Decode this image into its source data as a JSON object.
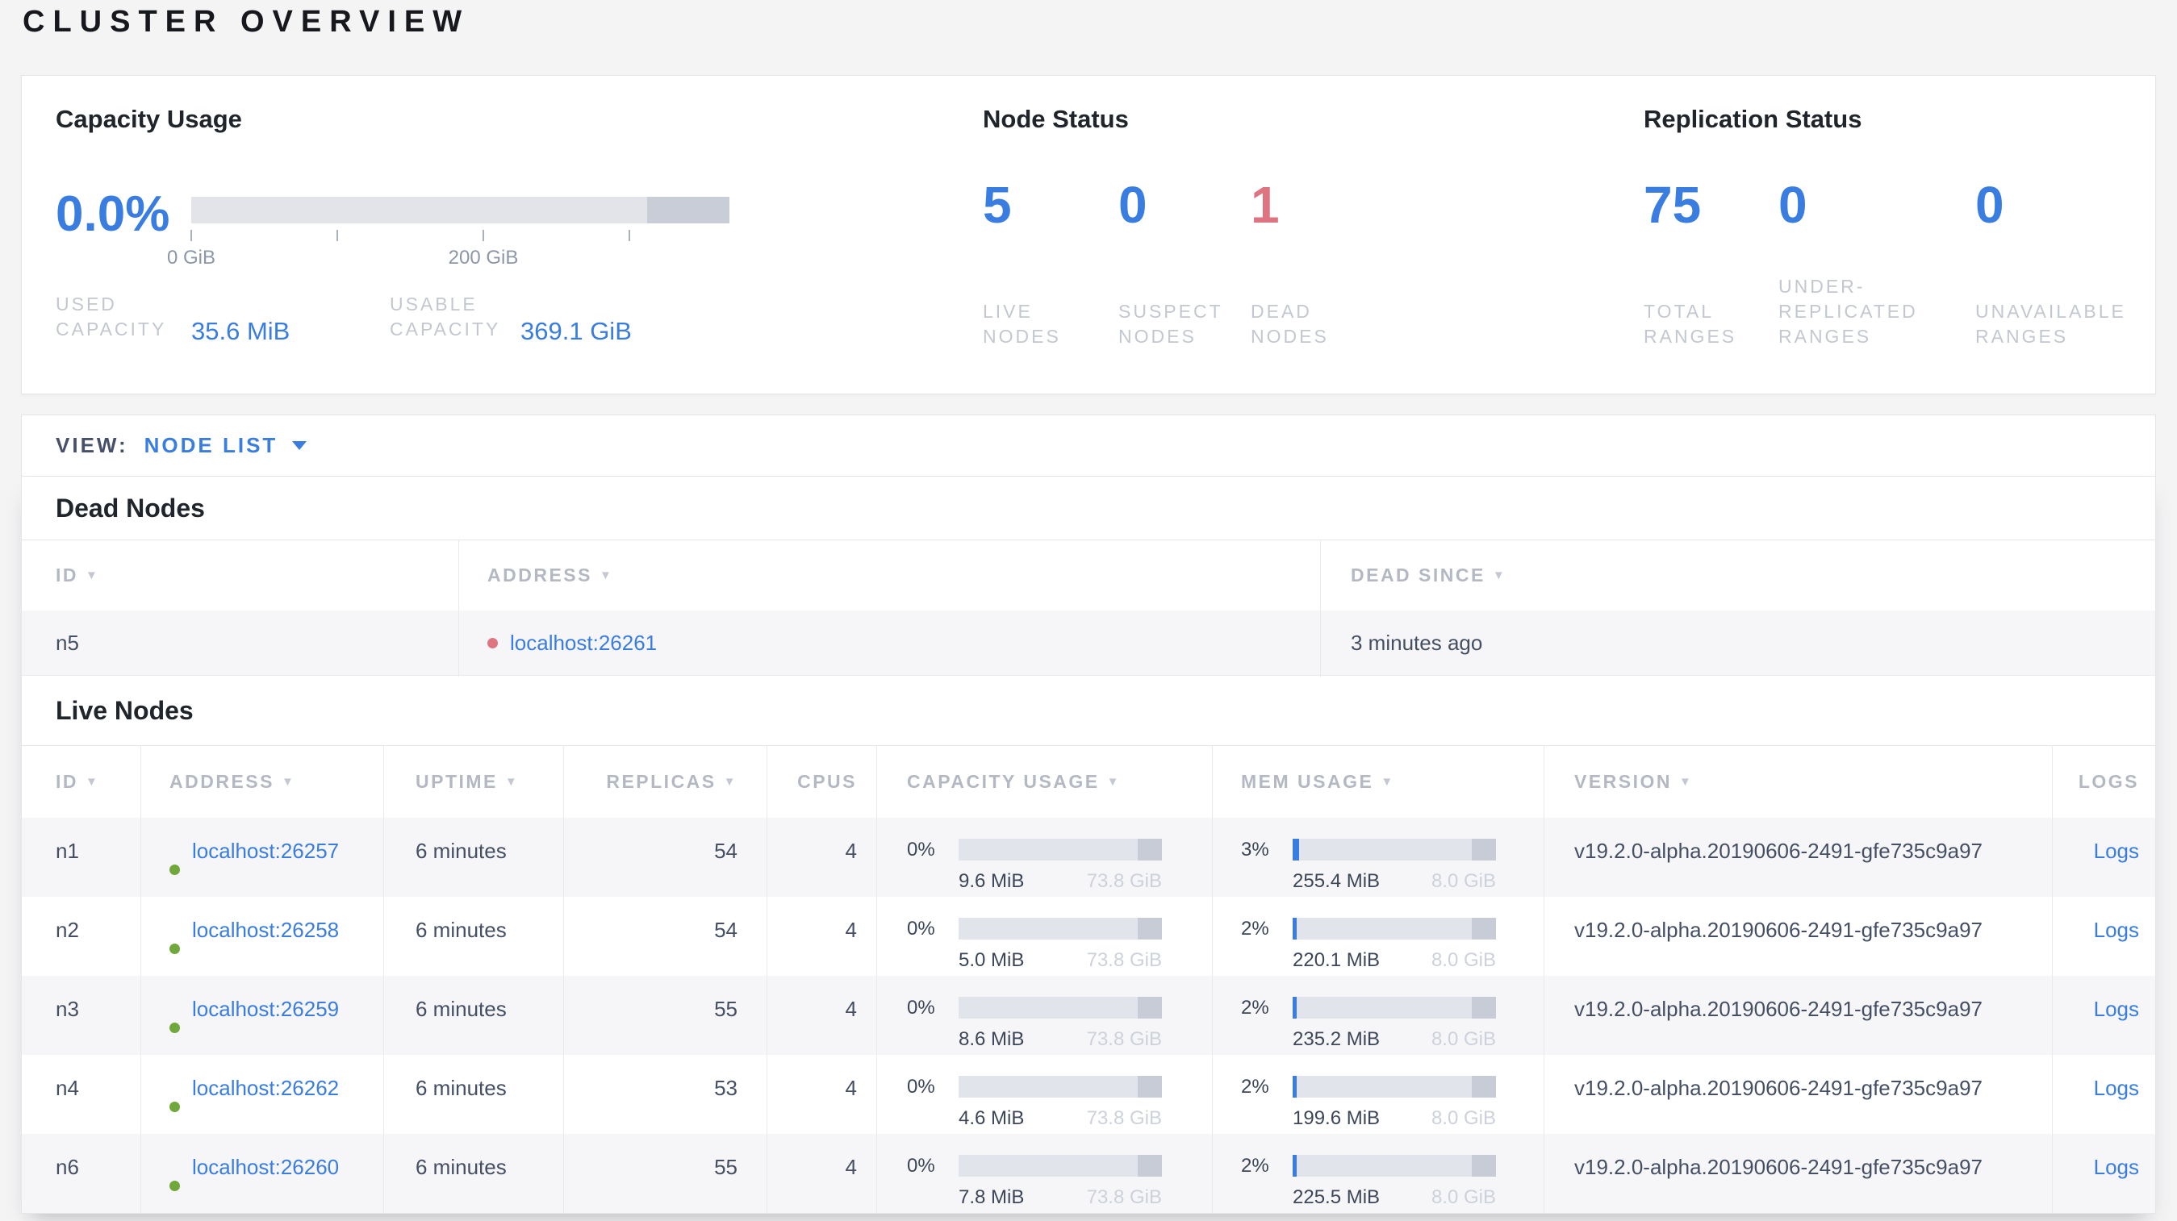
{
  "page_title": "CLUSTER OVERVIEW",
  "colors": {
    "accent_blue": "#3a7de1",
    "danger_rose": "#de7481",
    "live_green": "#71a83c",
    "meter_track": "#e1e4eb",
    "meter_reserved": "#c8ccd7"
  },
  "summary": {
    "capacity": {
      "title": "Capacity Usage",
      "percent": "0.0%",
      "tick_labels": [
        "0 GiB",
        "200 GiB"
      ],
      "stats": [
        {
          "label": "USED\nCAPACITY",
          "value": "35.6 MiB"
        },
        {
          "label": "USABLE\nCAPACITY",
          "value": "369.1 GiB"
        }
      ]
    },
    "node_status": {
      "title": "Node Status",
      "stats": [
        {
          "value": "5",
          "label": "LIVE\nNODES",
          "color": "#3a7de1"
        },
        {
          "value": "0",
          "label": "SUSPECT\nNODES",
          "color": "#3a7de1"
        },
        {
          "value": "1",
          "label": "DEAD\nNODES",
          "color": "#de7481"
        }
      ]
    },
    "replication": {
      "title": "Replication Status",
      "stats": [
        {
          "value": "75",
          "label": "TOTAL\nRANGES",
          "color": "#3a7de1"
        },
        {
          "value": "0",
          "label": "UNDER-\nREPLICATED\nRANGES",
          "color": "#3a7de1"
        },
        {
          "value": "0",
          "label": "UNAVAILABLE\nRANGES",
          "color": "#3a7de1"
        }
      ]
    }
  },
  "view_bar": {
    "label": "VIEW:",
    "selected": "NODE LIST"
  },
  "dead_nodes": {
    "title": "Dead Nodes",
    "columns": [
      {
        "label": "ID",
        "sortable": true
      },
      {
        "label": "ADDRESS",
        "sortable": true
      },
      {
        "label": "DEAD SINCE",
        "sortable": true
      }
    ],
    "rows": [
      {
        "id": "n5",
        "address": "localhost:26261",
        "dead_since": "3 minutes ago"
      }
    ]
  },
  "live_nodes": {
    "title": "Live Nodes",
    "columns": [
      {
        "label": "ID",
        "sortable": true
      },
      {
        "label": "ADDRESS",
        "sortable": true
      },
      {
        "label": "UPTIME",
        "sortable": true
      },
      {
        "label": "REPLICAS",
        "sortable": true
      },
      {
        "label": "CPUS",
        "sortable": false
      },
      {
        "label": "CAPACITY USAGE",
        "sortable": true
      },
      {
        "label": "MEM USAGE",
        "sortable": true
      },
      {
        "label": "VERSION",
        "sortable": true
      },
      {
        "label": "LOGS",
        "sortable": false
      }
    ],
    "rows": [
      {
        "id": "n1",
        "address": "localhost:26257",
        "uptime": "6 minutes",
        "replicas": "54",
        "cpus": "4",
        "capacity": {
          "percent": "0%",
          "percent_num": 0,
          "used": "9.6 MiB",
          "total": "73.8 GiB"
        },
        "memory": {
          "percent": "3%",
          "percent_num": 3,
          "used": "255.4 MiB",
          "total": "8.0 GiB"
        },
        "version": "v19.2.0-alpha.20190606-2491-gfe735c9a97",
        "logs_label": "Logs"
      },
      {
        "id": "n2",
        "address": "localhost:26258",
        "uptime": "6 minutes",
        "replicas": "54",
        "cpus": "4",
        "capacity": {
          "percent": "0%",
          "percent_num": 0,
          "used": "5.0 MiB",
          "total": "73.8 GiB"
        },
        "memory": {
          "percent": "2%",
          "percent_num": 2,
          "used": "220.1 MiB",
          "total": "8.0 GiB"
        },
        "version": "v19.2.0-alpha.20190606-2491-gfe735c9a97",
        "logs_label": "Logs"
      },
      {
        "id": "n3",
        "address": "localhost:26259",
        "uptime": "6 minutes",
        "replicas": "55",
        "cpus": "4",
        "capacity": {
          "percent": "0%",
          "percent_num": 0,
          "used": "8.6 MiB",
          "total": "73.8 GiB"
        },
        "memory": {
          "percent": "2%",
          "percent_num": 2,
          "used": "235.2 MiB",
          "total": "8.0 GiB"
        },
        "version": "v19.2.0-alpha.20190606-2491-gfe735c9a97",
        "logs_label": "Logs"
      },
      {
        "id": "n4",
        "address": "localhost:26262",
        "uptime": "6 minutes",
        "replicas": "53",
        "cpus": "4",
        "capacity": {
          "percent": "0%",
          "percent_num": 0,
          "used": "4.6 MiB",
          "total": "73.8 GiB"
        },
        "memory": {
          "percent": "2%",
          "percent_num": 2,
          "used": "199.6 MiB",
          "total": "8.0 GiB"
        },
        "version": "v19.2.0-alpha.20190606-2491-gfe735c9a97",
        "logs_label": "Logs"
      },
      {
        "id": "n6",
        "address": "localhost:26260",
        "uptime": "6 minutes",
        "replicas": "55",
        "cpus": "4",
        "capacity": {
          "percent": "0%",
          "percent_num": 0,
          "used": "7.8 MiB",
          "total": "73.8 GiB"
        },
        "memory": {
          "percent": "2%",
          "percent_num": 2,
          "used": "225.5 MiB",
          "total": "8.0 GiB"
        },
        "version": "v19.2.0-alpha.20190606-2491-gfe735c9a97",
        "logs_label": "Logs"
      }
    ]
  }
}
